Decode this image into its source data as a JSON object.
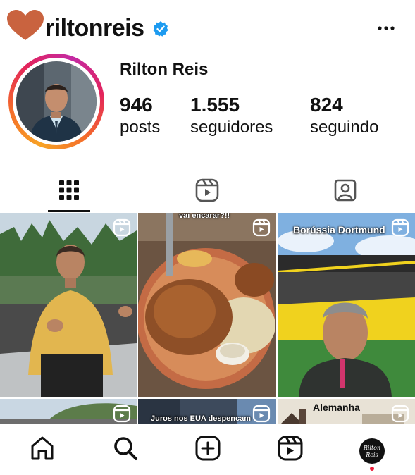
{
  "header": {
    "username": "riltonreis",
    "icons": {
      "heart": "heart-icon",
      "verified": "verified-badge-icon",
      "more": "more-options-icon"
    },
    "colors": {
      "heart": "#c9633f",
      "verified": "#1d9bf0"
    }
  },
  "profile": {
    "full_name": "Rilton Reis",
    "stats": [
      {
        "value": "946",
        "label": "posts"
      },
      {
        "value": "1.555",
        "label": "seguidores"
      },
      {
        "value": "824",
        "label": "seguindo"
      }
    ]
  },
  "tabs": [
    {
      "icon": "grid-icon",
      "selected": true
    },
    {
      "icon": "reels-icon",
      "selected": false
    },
    {
      "icon": "tagged-icon",
      "selected": false
    }
  ],
  "posts": [
    {
      "type": "reel",
      "caption": ""
    },
    {
      "type": "reel",
      "caption": "vai encarar?!!"
    },
    {
      "type": "reel",
      "caption": "Borússia Dortmund"
    },
    {
      "type": "reel",
      "caption": ""
    },
    {
      "type": "reel",
      "caption": "Juros nos EUA despencam"
    },
    {
      "type": "reel",
      "caption": "Alemanha"
    }
  ],
  "bottom_nav": {
    "items": [
      "home-icon",
      "search-icon",
      "create-icon",
      "reels-icon",
      "profile-avatar"
    ],
    "profile_avatar_text": "Rilton Reis"
  }
}
